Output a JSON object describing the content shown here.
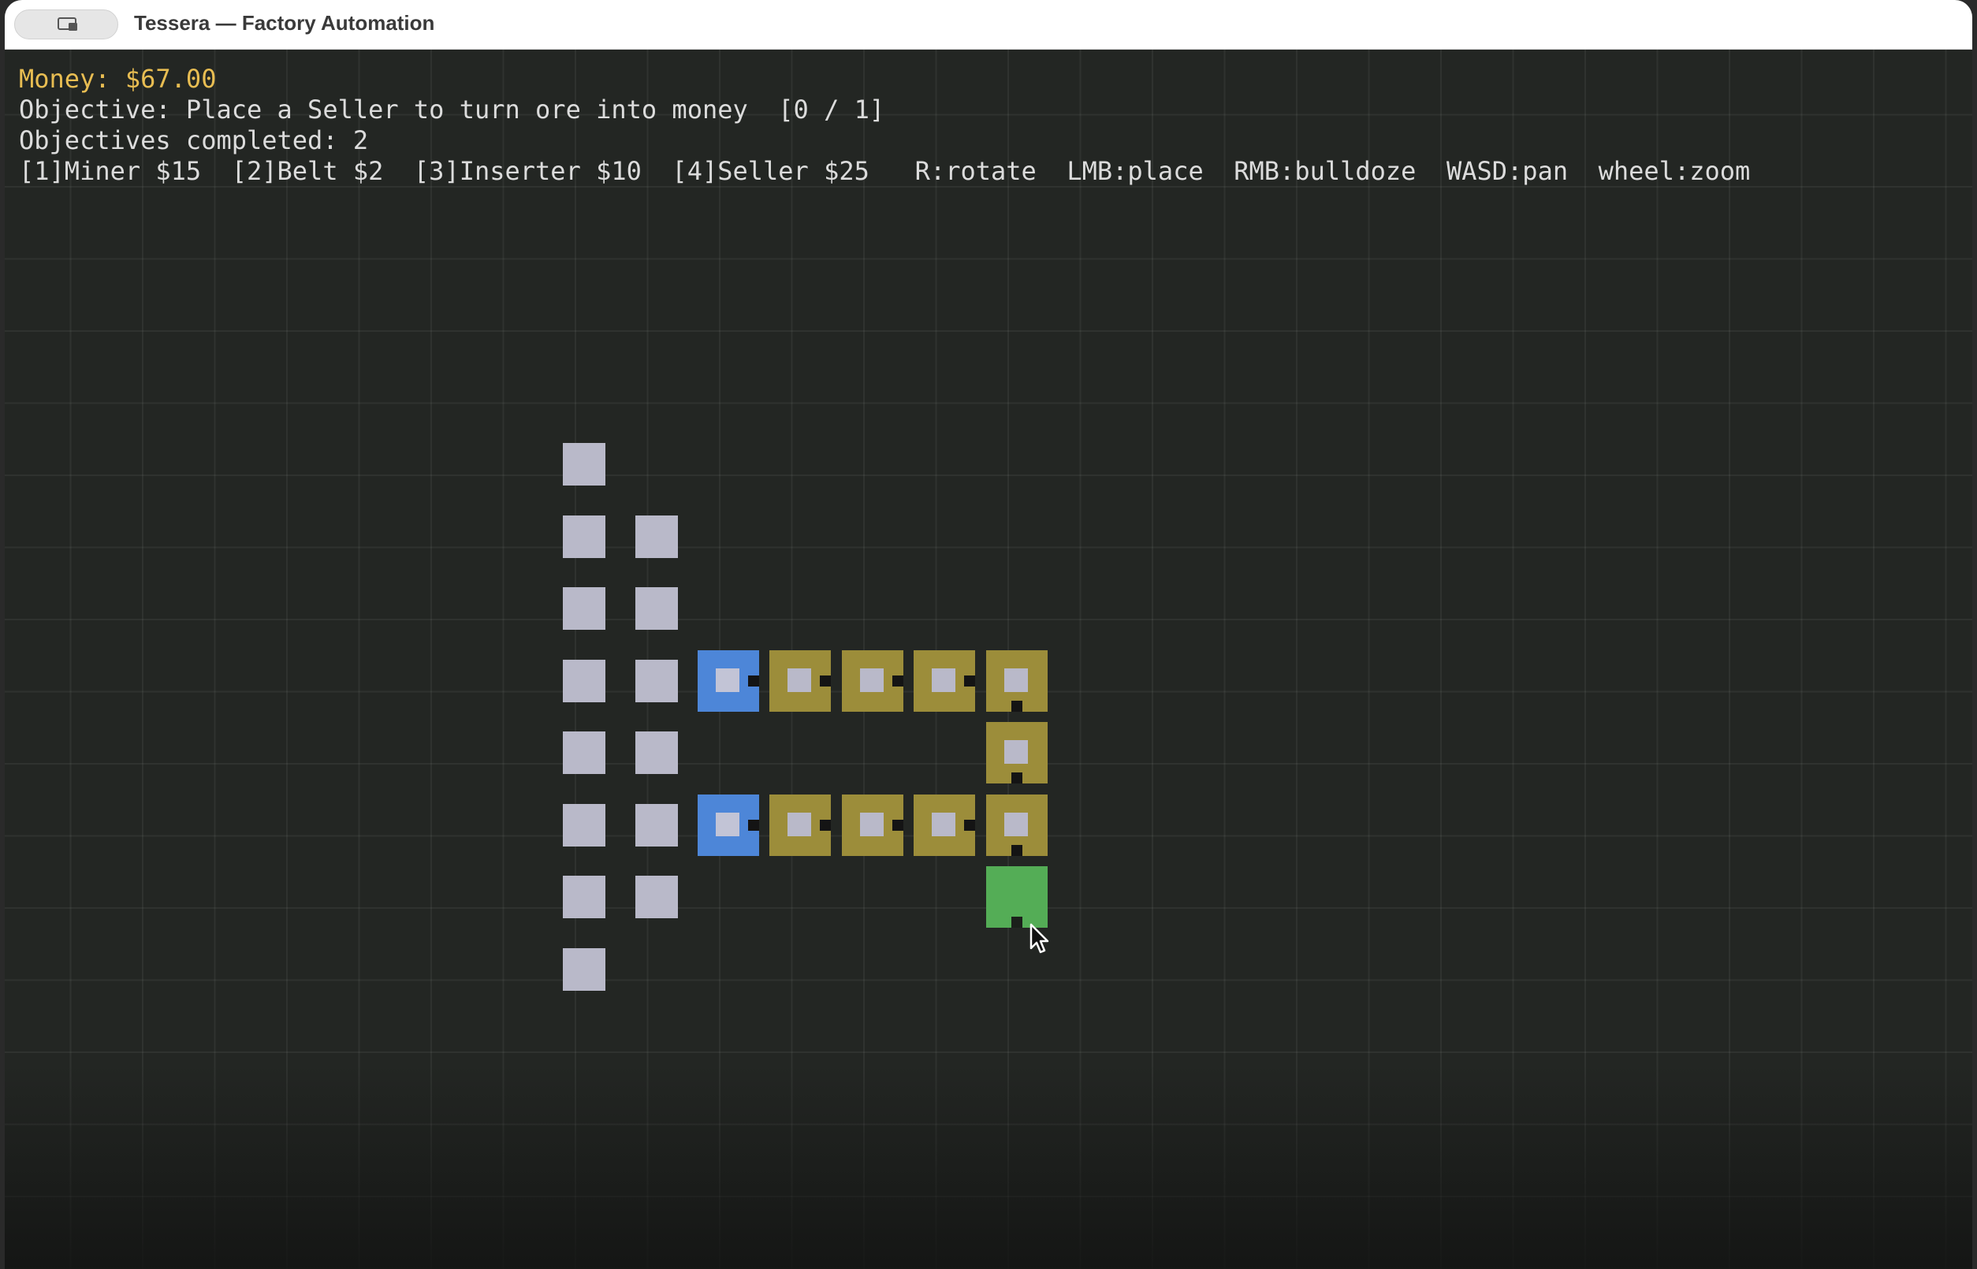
{
  "window": {
    "title": "Tessera — Factory Automation"
  },
  "hud": {
    "money": "Money: $67.00",
    "objective": "Objective: Place a Seller to turn ore into money  [0 / 1]",
    "completed": "Objectives completed: 2",
    "help": "[1]Miner $15  [2]Belt $2  [3]Inserter $10  [4]Seller $25   R:rotate  LMB:place  RMB:bulldoze  WASD:pan  wheel:zoom"
  },
  "colors": {
    "money": "#e8bd52",
    "ore": "#b9b9c9",
    "miner": "#4d86d8",
    "belt": "#9c8d3a",
    "seller": "#54ad56",
    "background": "#232623"
  }
}
